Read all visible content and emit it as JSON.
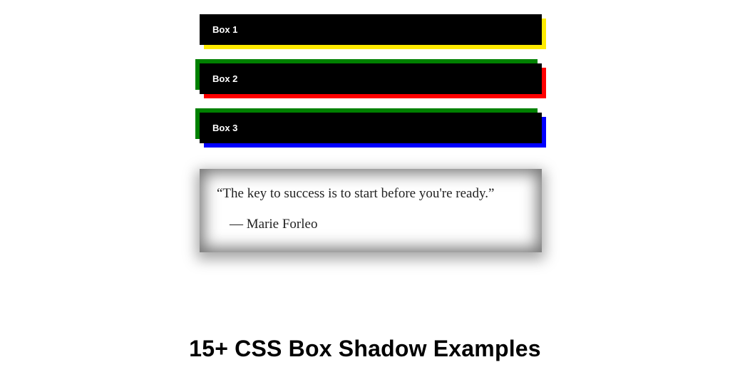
{
  "boxes": {
    "box1": {
      "label": "Box 1"
    },
    "box2": {
      "label": "Box 2"
    },
    "box3": {
      "label": "Box 3"
    }
  },
  "quote": {
    "text": "“The key to success is to start before you're ready.”",
    "author": "— Marie Forleo"
  },
  "heading": "15+ CSS Box Shadow Examples"
}
